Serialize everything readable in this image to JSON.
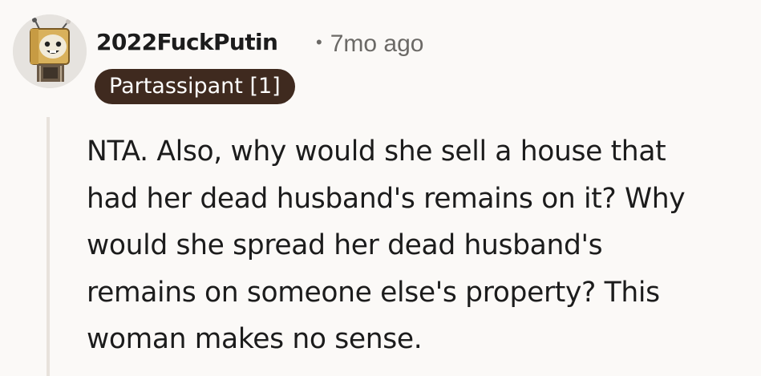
{
  "comment": {
    "username": "2022FuckPutin",
    "separator": "•",
    "timestamp": "7mo ago",
    "flair": "Partassipant [1]",
    "body_lines": [
      "NTA. Also, why would she sell a house that",
      "had her dead husband's remains on it? Why",
      "would she spread her dead husband's",
      "remains on someone else's property? This",
      "woman makes no sense."
    ]
  },
  "colors": {
    "background": "#fbf9f7",
    "flair_bg": "#3f2a1f",
    "meta_text": "#6b6966",
    "thread_line": "#e8e2dc"
  },
  "icons": {
    "avatar": "robot-box-avatar-icon"
  }
}
